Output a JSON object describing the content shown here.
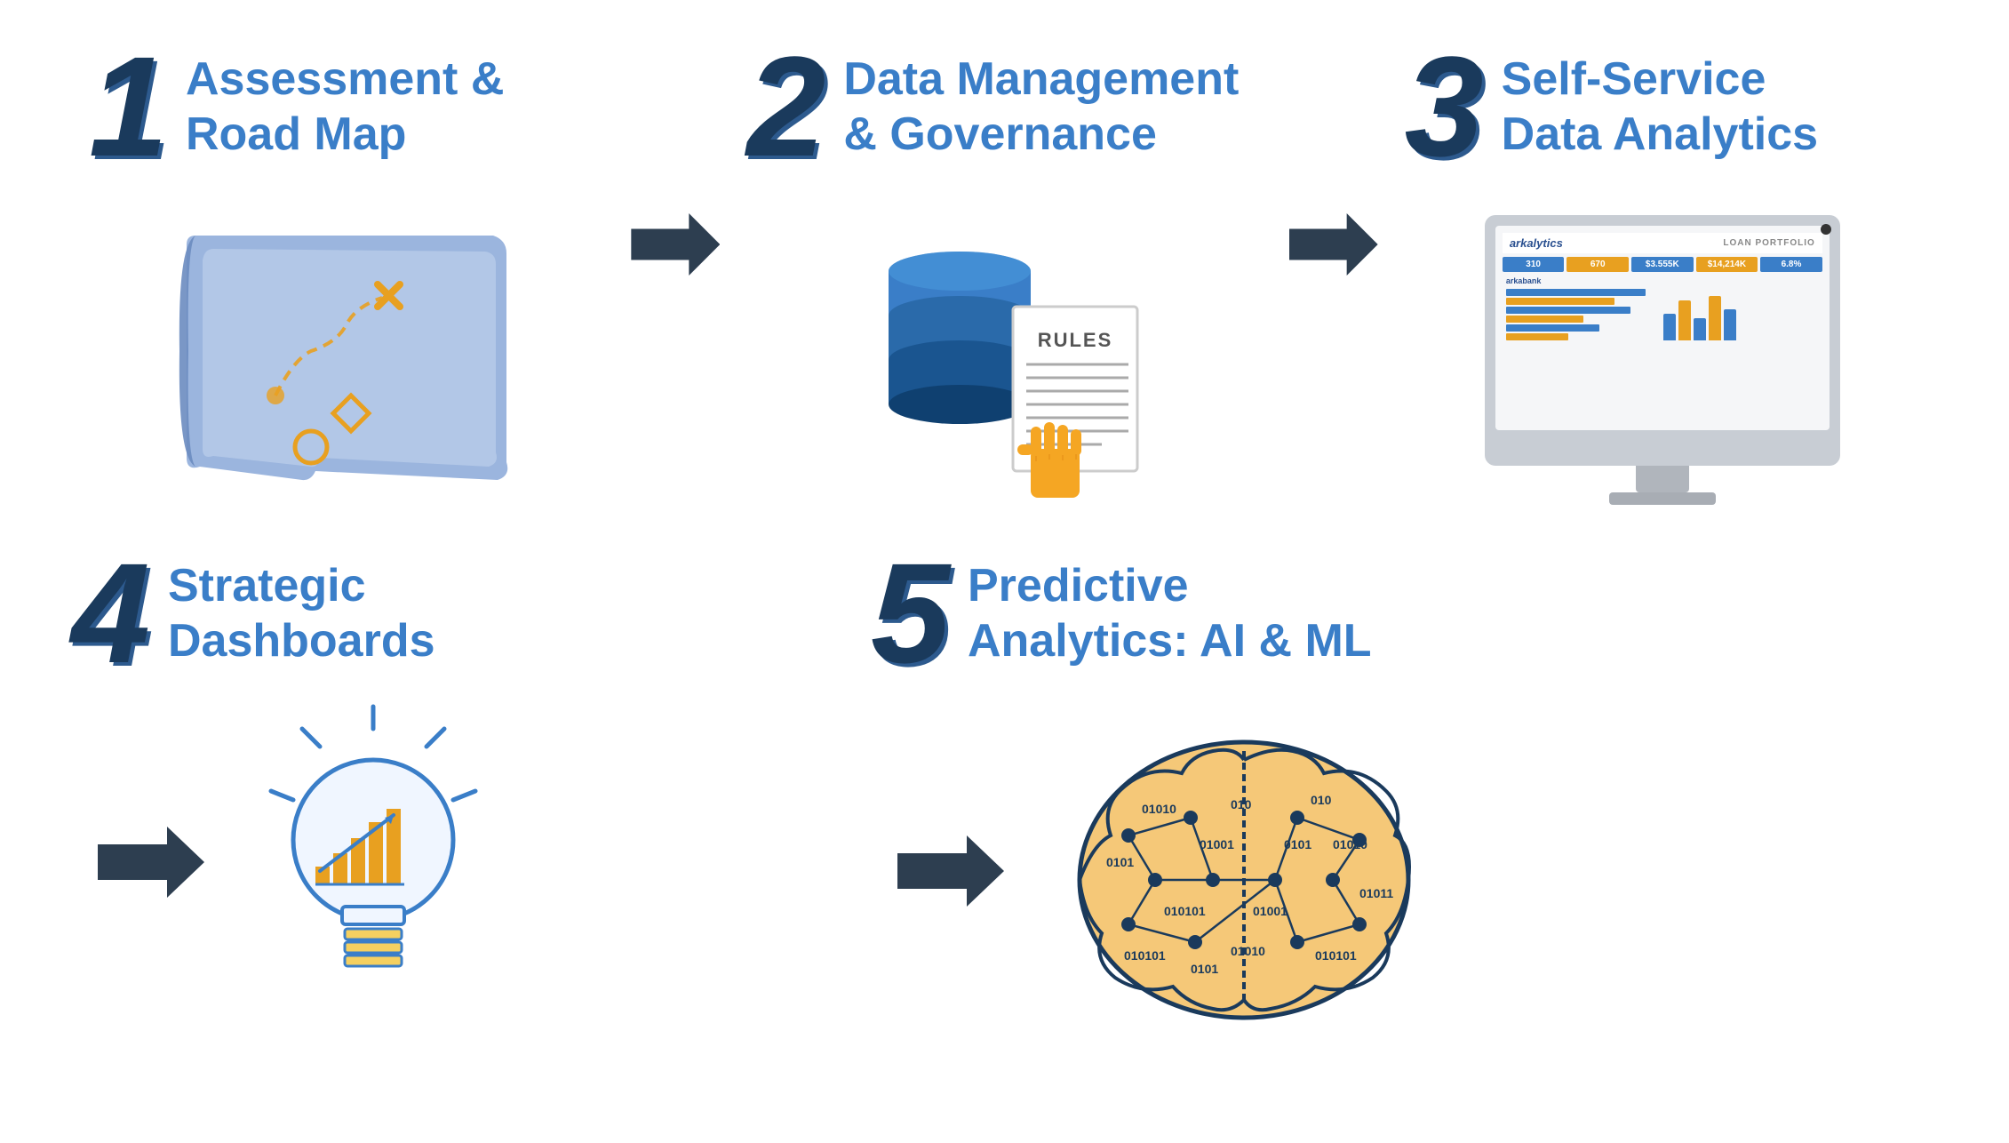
{
  "page": {
    "background": "#ffffff"
  },
  "steps": [
    {
      "number": "1",
      "title_line1": "Assessment &",
      "title_line2": "Road Map",
      "illustration": "map"
    },
    {
      "number": "2",
      "title_line1": "Data Management",
      "title_line2": "& Governance",
      "illustration": "database-rules"
    },
    {
      "number": "3",
      "title_line1": "Self-Service",
      "title_line2": "Data Analytics",
      "illustration": "monitor"
    },
    {
      "number": "4",
      "title_line1": "Strategic",
      "title_line2": "Dashboards",
      "illustration": "lightbulb"
    },
    {
      "number": "5",
      "title_line1": "Predictive",
      "title_line2": "Analytics: AI & ML",
      "illustration": "brain"
    }
  ],
  "monitor": {
    "logo": "arkalytics",
    "portfolio_label": "LOAN PORTFOLIO",
    "metrics": [
      "310",
      "670",
      "$3.555K",
      "$14,214K",
      "6.8%"
    ]
  },
  "arrows": {
    "count": 4
  }
}
